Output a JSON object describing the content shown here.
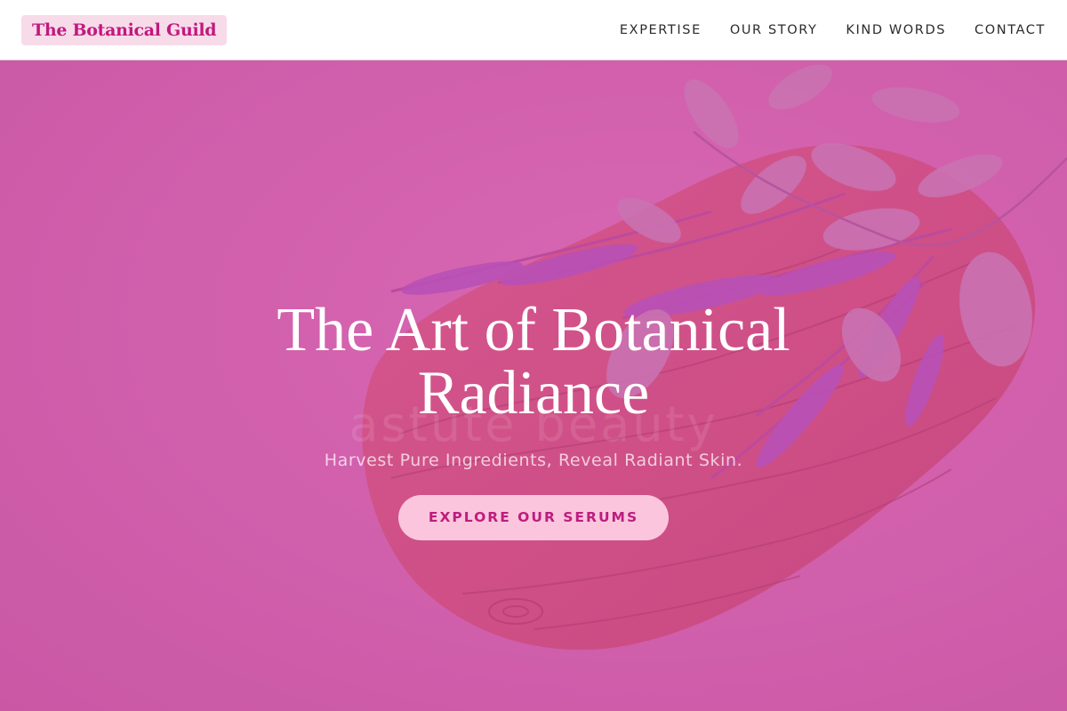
{
  "header": {
    "brand": "The Botanical Guild",
    "nav": [
      "EXPERTISE",
      "OUR STORY",
      "KIND WORDS",
      "CONTACT"
    ]
  },
  "hero": {
    "title_line1": "The Art of Botanical",
    "title_line2": "Radiance",
    "ghost_text": "astute beauty",
    "subtitle": "Harvest Pure Ingredients, Reveal Radiant Skin.",
    "cta_label": "EXPLORE OUR SERUMS"
  },
  "colors": {
    "accent": "#c2187e",
    "hero_bg": "#d064ad",
    "cta_bg": "#fbc6dd"
  }
}
